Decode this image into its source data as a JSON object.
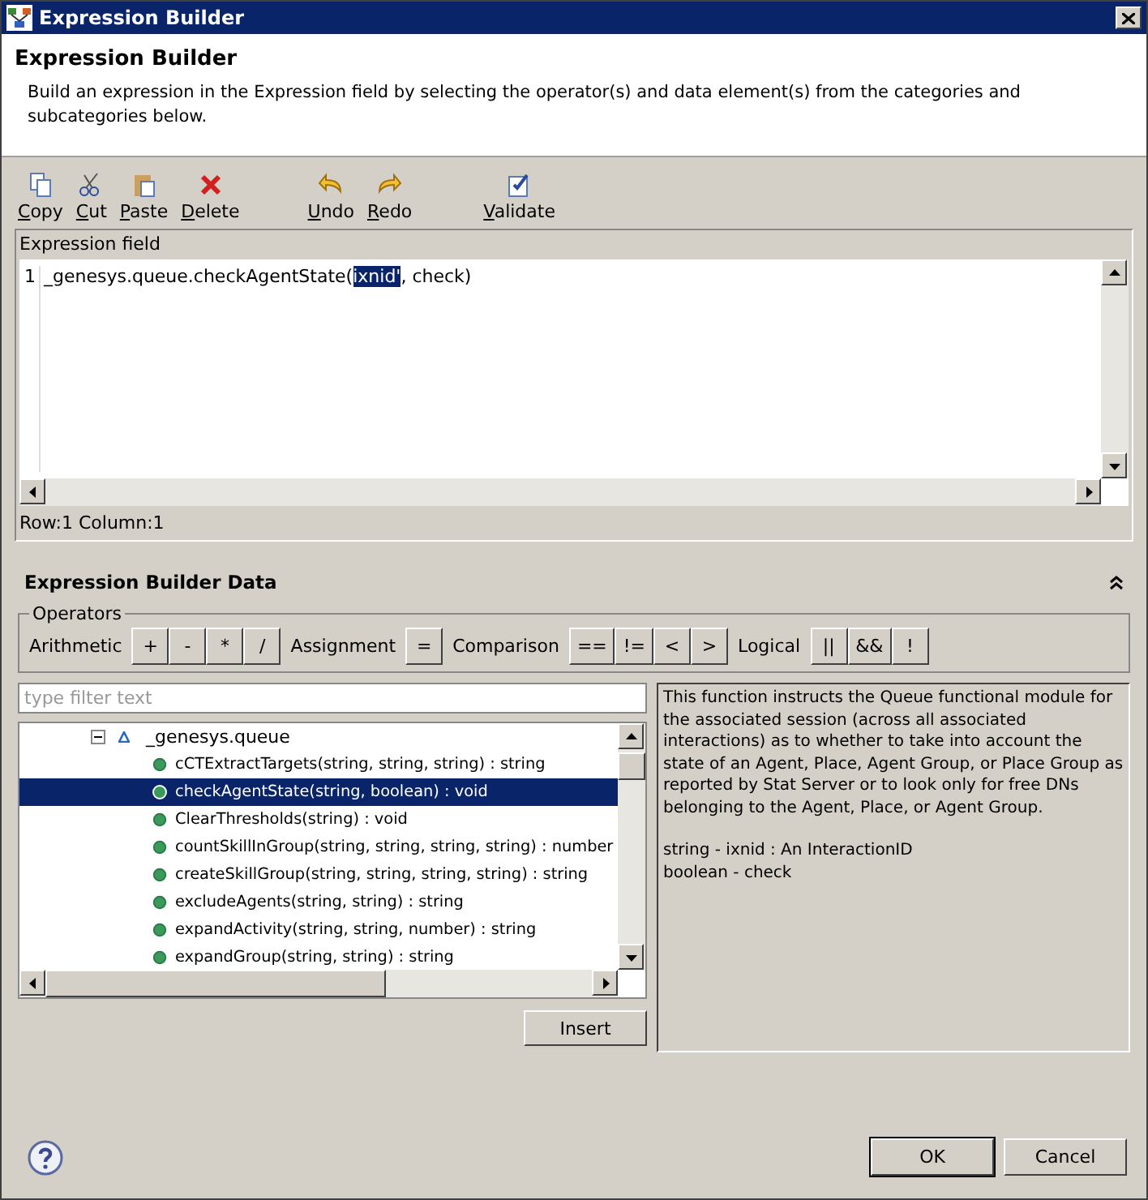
{
  "window": {
    "title": "Expression Builder"
  },
  "header": {
    "title": "Expression Builder",
    "description": "Build an expression in the Expression field by selecting the operator(s) and data element(s) from the categories and subcategories below."
  },
  "toolbar": [
    {
      "label": "Copy",
      "kind": "copy"
    },
    {
      "label": "Cut",
      "kind": "cut"
    },
    {
      "label": "Paste",
      "kind": "paste"
    },
    {
      "label": "Delete",
      "kind": "delete"
    },
    {
      "label": "Undo",
      "kind": "undo"
    },
    {
      "label": "Redo",
      "kind": "redo"
    },
    {
      "label": "Validate",
      "kind": "validate"
    }
  ],
  "expression_field": {
    "label": "Expression field",
    "line_number": "1",
    "text_before": "_genesys.queue.checkAgentState(",
    "selection": "ixnid'",
    "text_after": ", check)",
    "status": "Row:1 Column:1"
  },
  "data_section": {
    "title": "Expression Builder Data",
    "expanded": true
  },
  "operators": {
    "title": "Operators",
    "groups": [
      {
        "label": "Arithmetic",
        "buttons": [
          "+",
          "-",
          "*",
          "/"
        ]
      },
      {
        "label": "Assignment",
        "buttons": [
          "="
        ]
      },
      {
        "label": "Comparison",
        "buttons": [
          "==",
          "!=",
          "<",
          ">"
        ]
      },
      {
        "label": "Logical",
        "buttons": [
          "||",
          "&&",
          "!"
        ]
      }
    ]
  },
  "filter": {
    "placeholder": "type filter text"
  },
  "tree": {
    "label": "_genesys.queue",
    "expanded": true,
    "children": [
      {
        "label": "cCTExtractTargets(string, string, string) : string",
        "selected": false
      },
      {
        "label": "checkAgentState(string, boolean) : void",
        "selected": true
      },
      {
        "label": "ClearThresholds(string) : void",
        "selected": false
      },
      {
        "label": "countSkillInGroup(string, string, string, string) : number",
        "selected": false
      },
      {
        "label": "createSkillGroup(string, string, string, string) : string",
        "selected": false
      },
      {
        "label": "excludeAgents(string, string) : string",
        "selected": false
      },
      {
        "label": "expandActivity(string, string, number) : string",
        "selected": false
      },
      {
        "label": "expandGroup(string, string) : string",
        "selected": false
      }
    ]
  },
  "insert_button": "Insert",
  "description": [
    "This function instructs the Queue functional module for the associated session (across all associated interactions) as to whether to take into account the state of an Agent, Place, Agent Group, or Place Group as reported by Stat Server or to look only for free DNs belonging to the Agent, Place, or Agent Group.",
    "string - ixnid : An InteractionID",
    "boolean - check"
  ],
  "buttons": [
    "OK",
    "Cancel"
  ]
}
